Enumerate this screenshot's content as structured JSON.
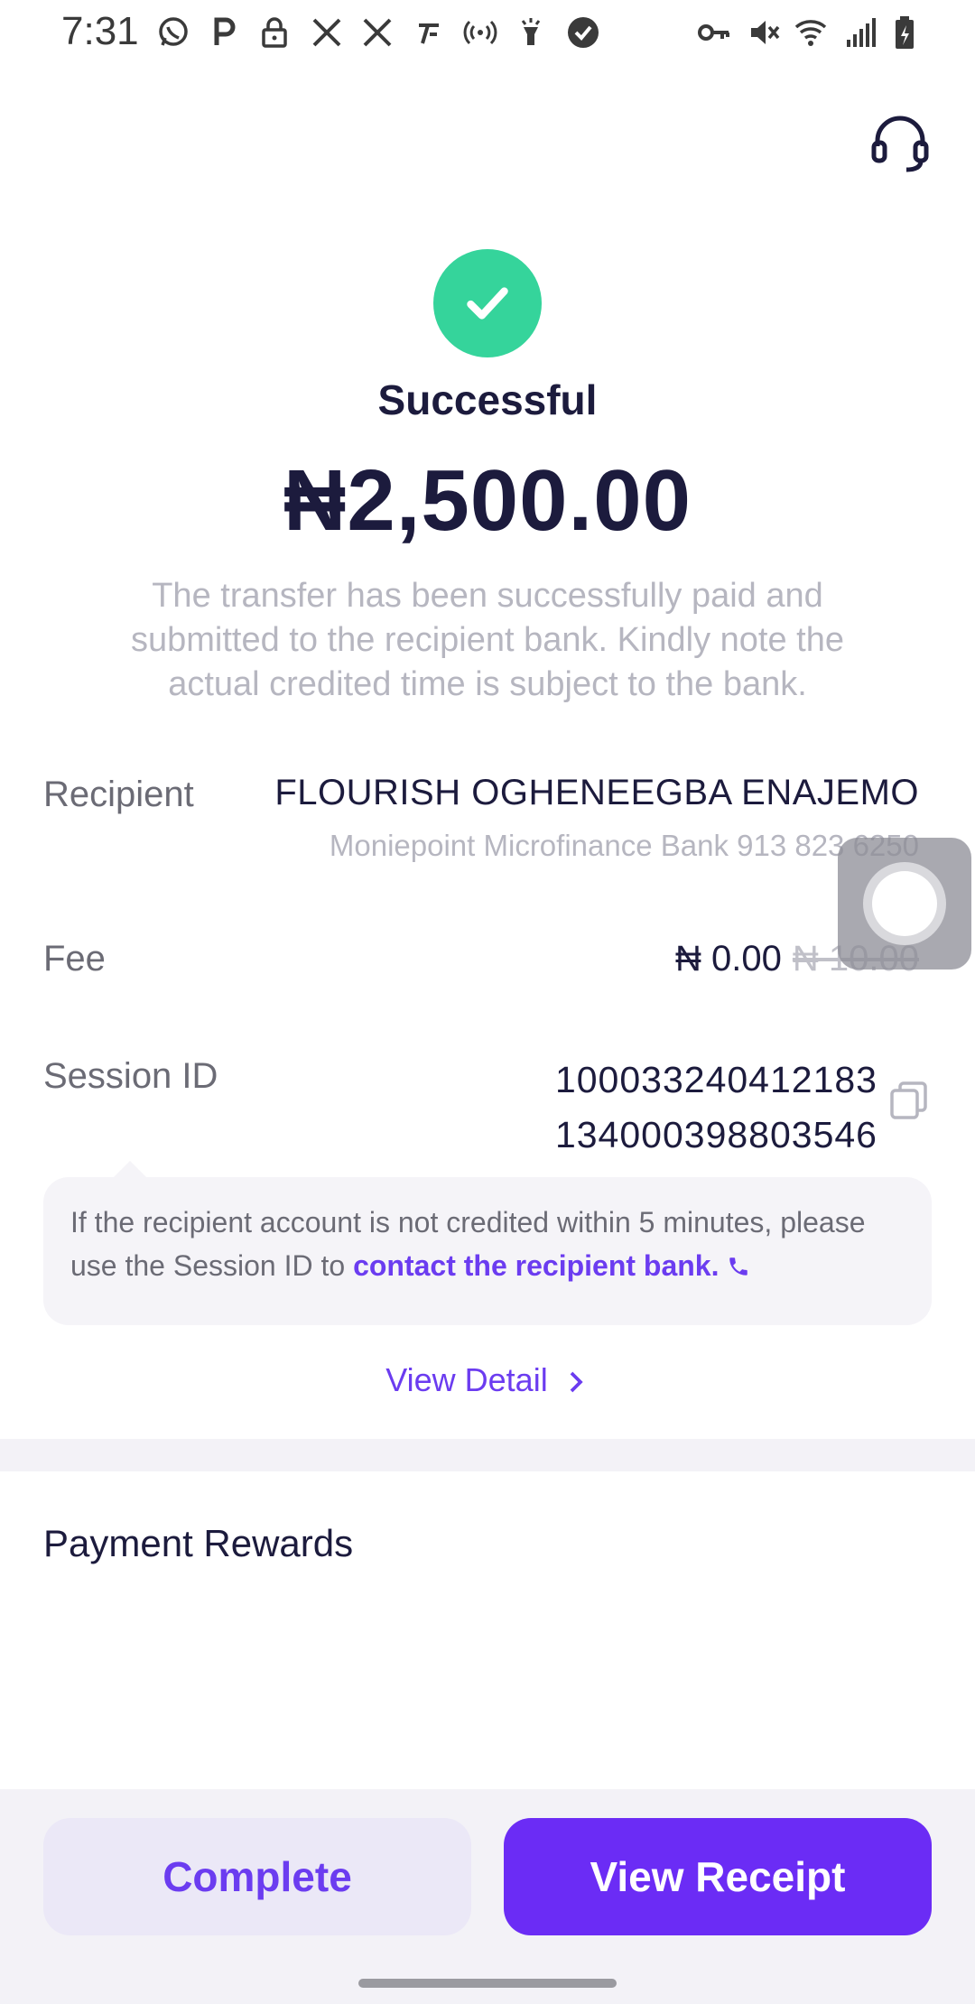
{
  "status_bar": {
    "time": "7:31",
    "left_icons": [
      "whatsapp-icon",
      "p-icon",
      "lock-icon",
      "x-icon",
      "x-icon",
      "tiktok-icon",
      "broadcast-icon",
      "flashlight-icon",
      "check-badge-icon"
    ],
    "right_icons": [
      "key-icon",
      "mute-icon",
      "wifi-icon",
      "signal-icon",
      "battery-icon"
    ]
  },
  "header": {
    "support_icon": "headset-icon"
  },
  "result": {
    "status": "Successful",
    "amount": "₦2,500.00",
    "description": "The transfer has been successfully paid and submitted to the recipient bank. Kindly note the actual credited time is subject to the bank."
  },
  "details": {
    "recipient_label": "Recipient",
    "recipient_name": "FLOURISH OGHENEEGBA ENAJEMO",
    "recipient_bank": "Moniepoint Microfinance Bank 913 823 6250",
    "fee_label": "Fee",
    "fee_value": "₦ 0.00",
    "fee_original": "₦ 10.00",
    "session_label": "Session ID",
    "session_line1": "100033240412183",
    "session_line2": "134000398803546"
  },
  "notice": {
    "text": "If the recipient account is not credited within 5 minutes, please use the Session ID to ",
    "link": "contact the recipient bank."
  },
  "view_detail": "View Detail",
  "rewards": {
    "title": "Payment Rewards"
  },
  "actions": {
    "complete": "Complete",
    "view_receipt": "View Receipt"
  },
  "colors": {
    "accent": "#6b2cf5",
    "success": "#35d49b",
    "text_dark": "#1c1b3d",
    "muted": "#b6b6c0"
  }
}
